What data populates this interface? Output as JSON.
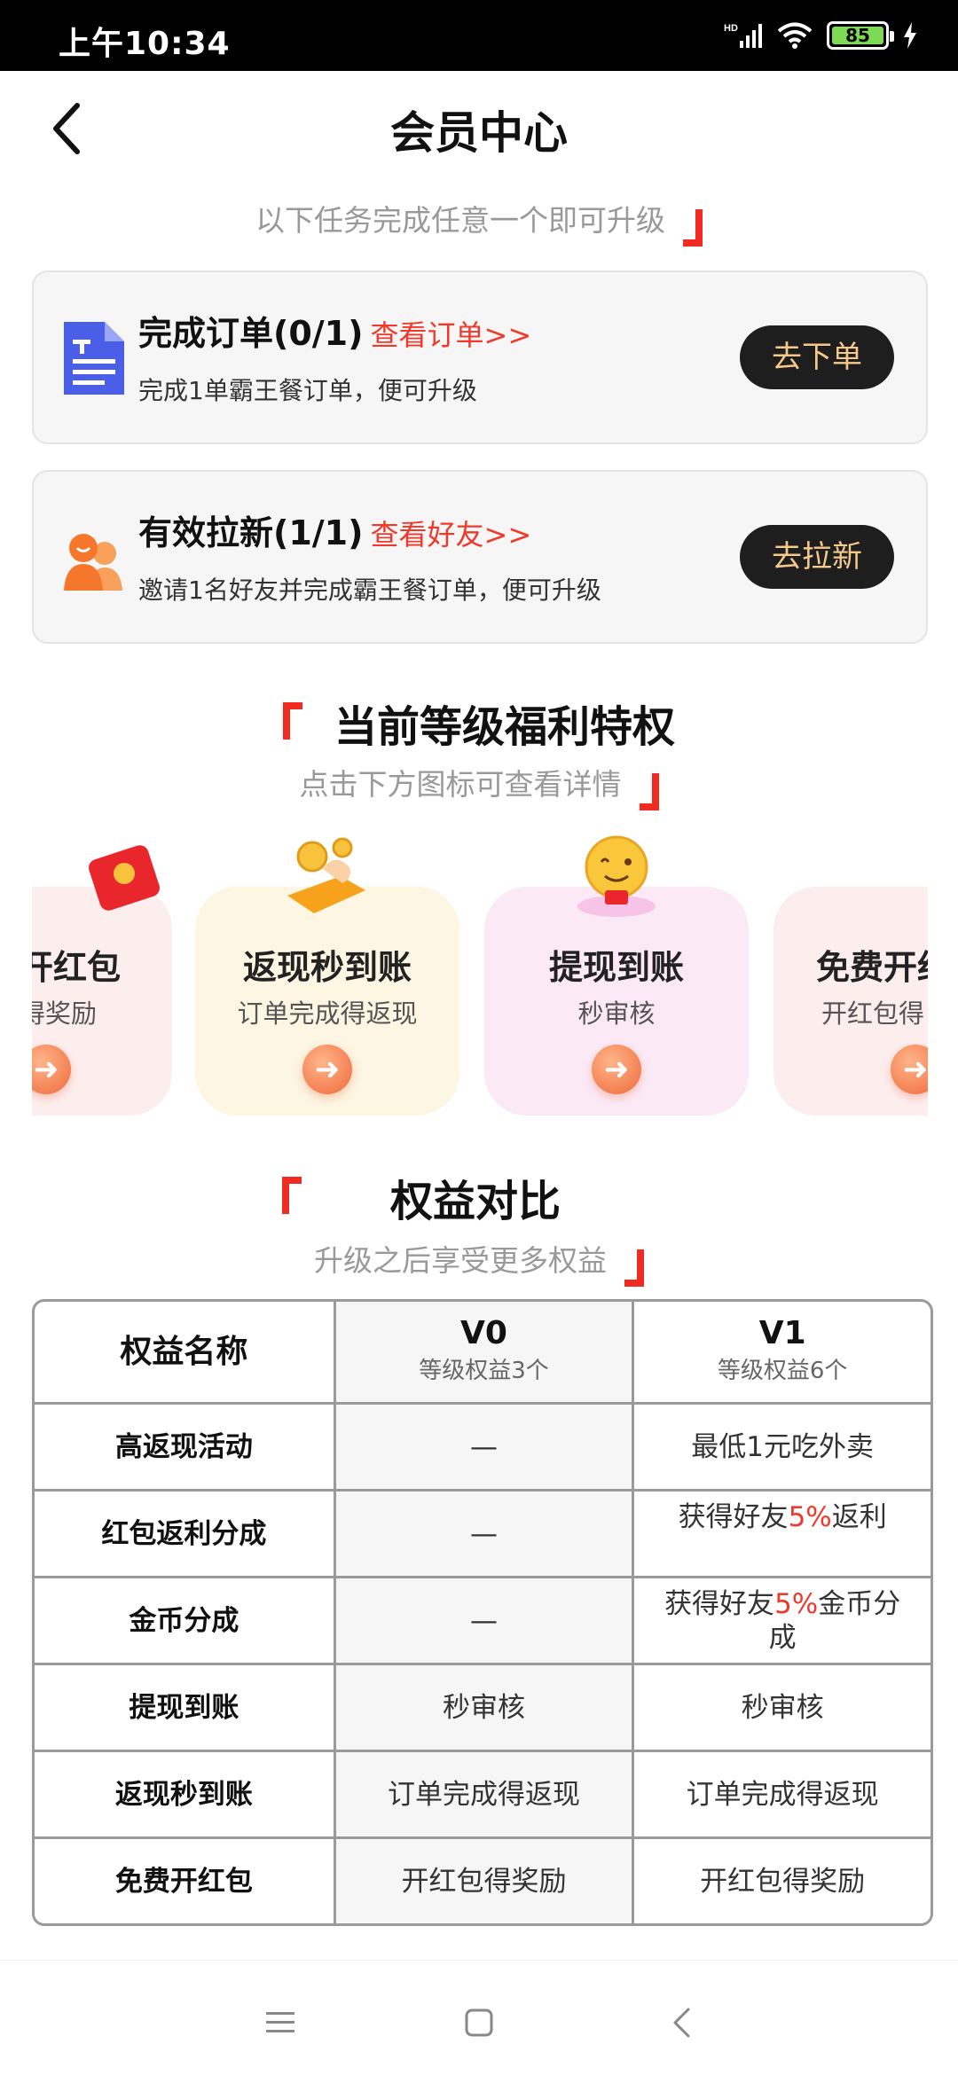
{
  "status": {
    "time": "上午10:34",
    "battery": "85",
    "network": "HD"
  },
  "header": {
    "title": "会员中心"
  },
  "tasks_hint": "以下任务完成任意一个即可升级",
  "tasks": [
    {
      "title": "完成订单(0/1)",
      "link": "查看订单>>",
      "desc": "完成1单霸王餐订单，便可升级",
      "button": "去下单"
    },
    {
      "title": "有效拉新(1/1)",
      "link": "查看好友>>",
      "desc": "邀请1名好友并完成霸王餐订单，便可升级",
      "button": "去拉新"
    }
  ],
  "privileges_section": {
    "title": "当前等级福利特权",
    "subtitle": "点击下方图标可查看详情"
  },
  "privileges": [
    {
      "title": "开红包",
      "sub": "得奖励",
      "icon": "red-envelope-icon",
      "bg": "#fdeeee"
    },
    {
      "title": "返现秒到账",
      "sub": "订单完成得返现",
      "icon": "cashback-hand-icon",
      "bg": "#fdf6e3"
    },
    {
      "title": "提现到账",
      "sub": "秒审核",
      "icon": "smiley-coin-icon",
      "bg": "#fbeaf6"
    },
    {
      "title": "免费开红",
      "sub": "开红包得",
      "icon": "red-envelope-icon",
      "bg": "#fdeeee"
    }
  ],
  "compare_section": {
    "title": "权益对比",
    "subtitle": "升级之后享受更多权益"
  },
  "compare_table": {
    "header": {
      "name": "权益名称",
      "v0": "V0",
      "v0_sub": "等级权益3个",
      "v1": "V1",
      "v1_sub": "等级权益6个"
    },
    "rows": [
      {
        "name": "高返现活动",
        "v0": "—",
        "v1": "最低1元吃外卖"
      },
      {
        "name": "红包返利分成",
        "v0": "—",
        "v1_pre": "获得好友",
        "v1_hl": "5%",
        "v1_post": "返利"
      },
      {
        "name": "金币分成",
        "v0": "—",
        "v1_pre": "获得好友",
        "v1_hl": "5%",
        "v1_post": "金币分成"
      },
      {
        "name": "提现到账",
        "v0": "秒审核",
        "v1": "秒审核"
      },
      {
        "name": "返现秒到账",
        "v0": "订单完成得返现",
        "v1": "订单完成得返现"
      },
      {
        "name": "免费开红包",
        "v0": "开红包得奖励",
        "v1": "开红包得奖励"
      }
    ]
  },
  "nav": {
    "menu_icon": "menu-icon",
    "home_icon": "home-square-icon",
    "back_icon": "back-triangle-icon"
  }
}
